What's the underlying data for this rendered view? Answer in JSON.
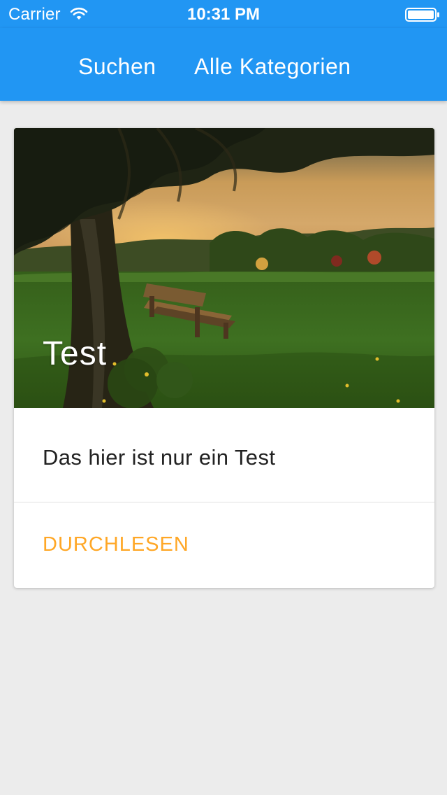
{
  "status_bar": {
    "carrier": "Carrier",
    "time": "10:31 PM",
    "wifi_icon": "wifi-icon",
    "battery_icon": "battery-icon"
  },
  "nav": {
    "tabs": [
      {
        "label": "Suchen"
      },
      {
        "label": "Alle Kategorien"
      }
    ],
    "color": "#2196f3"
  },
  "card": {
    "title": "Test",
    "description": "Das hier ist nur ein Test",
    "action_label": "DURCHLESEN",
    "action_color": "#ffa726",
    "image_icon": "park-bench-photo"
  }
}
